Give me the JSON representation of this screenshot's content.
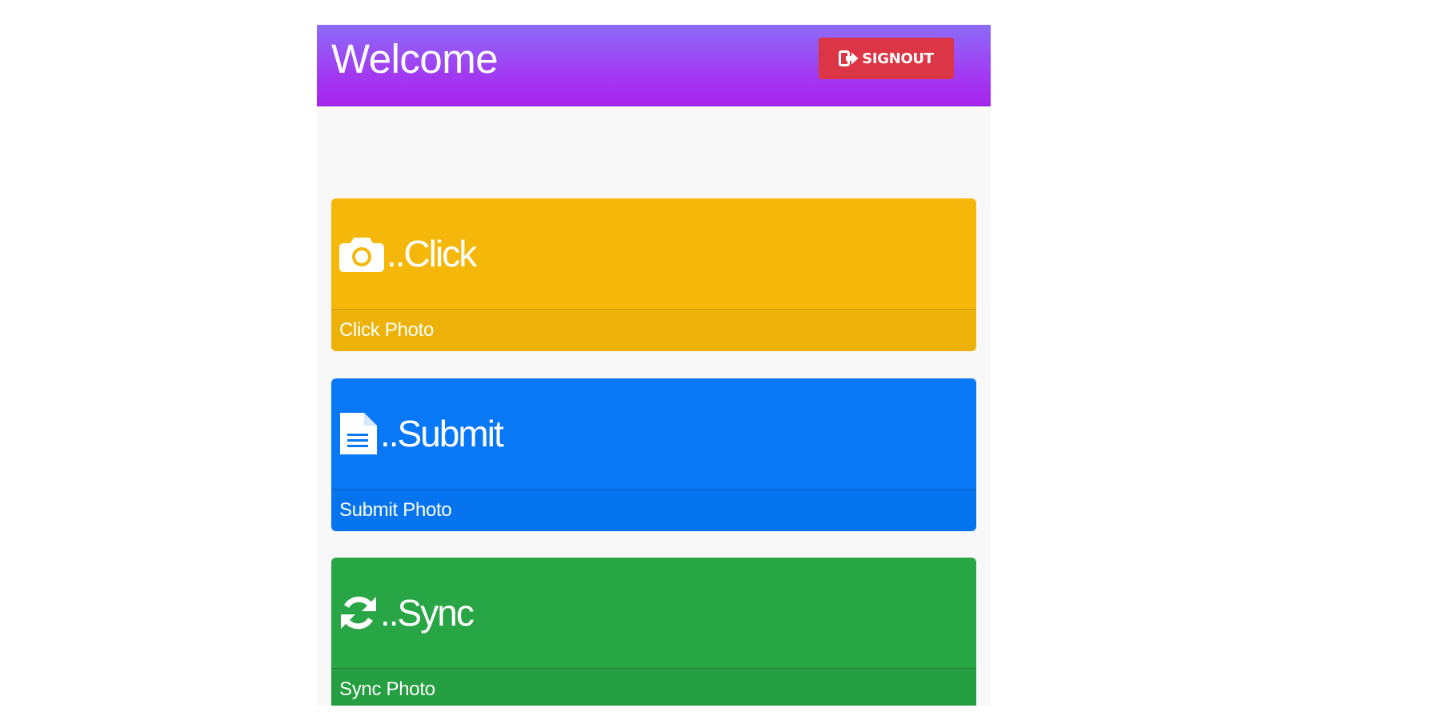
{
  "header": {
    "title": "Welcome",
    "signout_label": "SIGNOUT",
    "background_color": "#a13cf2"
  },
  "cards": [
    {
      "title": "..Click",
      "footer": "Click Photo",
      "icon": "camera-icon",
      "color": "#f5b80a"
    },
    {
      "title": "..Submit",
      "footer": "Submit Photo",
      "icon": "file-text-icon",
      "color": "#0878f7"
    },
    {
      "title": "..Sync",
      "footer": "Sync Photo",
      "icon": "refresh-icon",
      "color": "#28a545"
    }
  ],
  "colors": {
    "signout_button": "#dc3545",
    "content_background": "#f8f8f8"
  }
}
